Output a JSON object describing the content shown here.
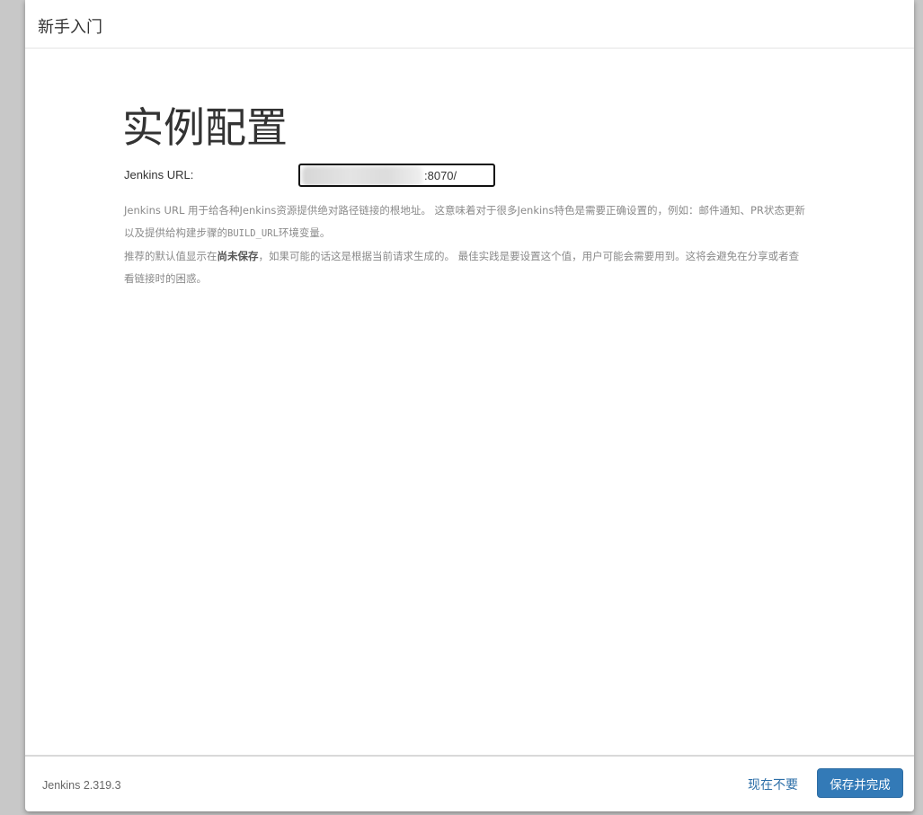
{
  "header": {
    "title": "新手入门"
  },
  "main": {
    "heading": "实例配置",
    "url_label": "Jenkins URL:",
    "url_value": ":8070/",
    "help_line1_part1": "Jenkins URL 用于给各种Jenkins资源提供绝对路径链接的根地址。 这意味着对于很多Jenkins特色是需要正确设置的，例如：邮件通知、PR状态更新以及提供给构建步骤的",
    "help_line1_code": "BUILD_URL",
    "help_line1_part2": "环境变量。",
    "help_line2_part1": "推荐的默认值显示在",
    "help_line2_strong": "尚未保存",
    "help_line2_part2": "，如果可能的话这是根据当前请求生成的。 最佳实践是要设置这个值，用户可能会需要用到。这将会避免在分享或者查看链接时的困惑。"
  },
  "footer": {
    "version": "Jenkins 2.319.3",
    "skip_label": "现在不要",
    "save_label": "保存并完成"
  },
  "colors": {
    "primary": "#337ab7",
    "link": "#2d6fa8",
    "help_text": "#8a8a8a"
  }
}
